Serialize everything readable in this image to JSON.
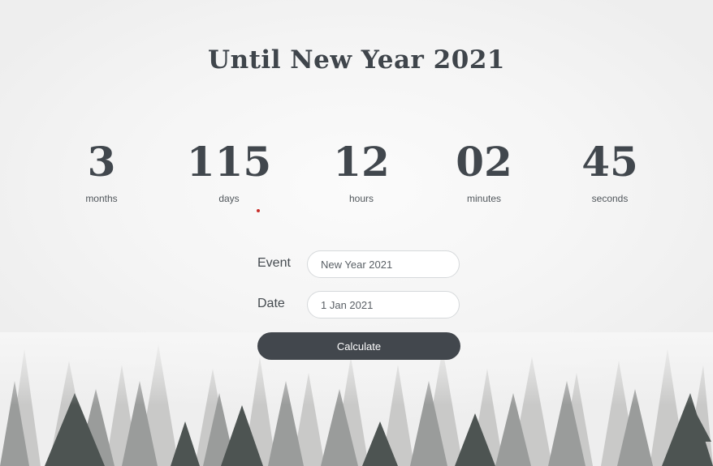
{
  "page": {
    "title": "Until New Year 2021"
  },
  "countdown": [
    {
      "value": "3",
      "unit": "months"
    },
    {
      "value": "115",
      "unit": "days"
    },
    {
      "value": "12",
      "unit": "hours"
    },
    {
      "value": "02",
      "unit": "minutes"
    },
    {
      "value": "45",
      "unit": "seconds"
    }
  ],
  "form": {
    "event_label": "Event",
    "event_value": "New Year 2021",
    "date_label": "Date",
    "date_value": "1 Jan 2021",
    "submit_label": "Calculate"
  },
  "colors": {
    "text": "#41474d",
    "button": "#42474d",
    "accent_dot": "#c9302c"
  }
}
